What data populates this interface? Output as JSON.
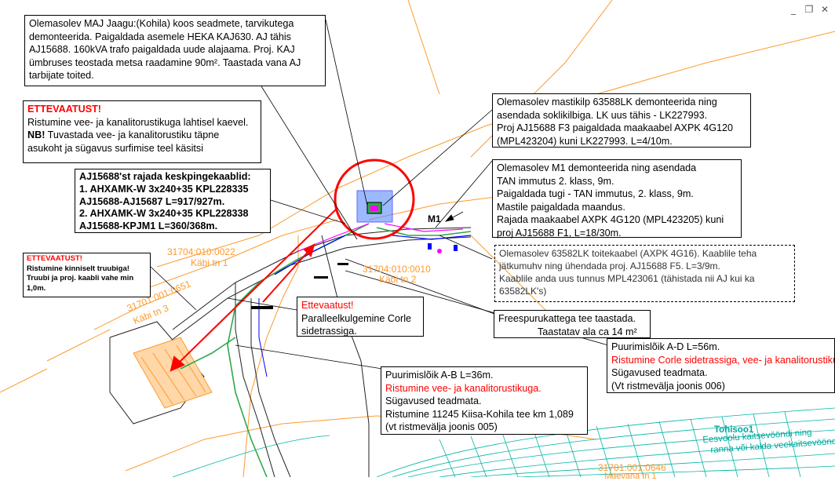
{
  "window_controls": {
    "minimize": "_",
    "restore": "❐",
    "close": "✕"
  },
  "notes": {
    "jaagu": {
      "lines": [
        "Olemasolev MAJ Jaagu:(Kohila) koos seadmete, tarvikutega",
        "demonteerida. Paigaldada asemele HEKA KAJ630. AJ tähis",
        "AJ15688. 160kVA trafo paigaldada uude alajaama. Proj. KAJ",
        "ümbruses teostada metsa raadamine 90m²",
        ". Taastada vana AJ",
        "tarbijate toited."
      ]
    },
    "warning1": {
      "title": "ETTEVAATUST!",
      "line1": "Ristumine vee- ja kanalitorustikuga lahtisel kaevel.",
      "nb": "NB!",
      "line2": " Tuvastada vee- ja kanalitorustiku täpne",
      "line3": "asukoht ja sügavus surfimise teel käsitsi"
    },
    "cables": {
      "lines": [
        "AJ15688'st rajada keskpingekaablid:",
        "1. AHXAMK-W 3x240+35 KPL228335",
        "AJ15688-AJ15687 L=917/927m.",
        "2. AHXAMK-W 3x240+35 KPL228338",
        "AJ15688-KPJM1 L=360/368m."
      ]
    },
    "warning2": {
      "title": "ETTEVAATUST!",
      "lines": [
        "Ristumine kinniselt truubiga!",
        "Truubi ja proj. kaabli vahe min",
        "1,0m."
      ]
    },
    "mastikilp": {
      "lines": [
        "Olemasolev mastikilp 63588LK demonteerida ning",
        "asendada soklikilbiga. LK uus tähis - LK227993.",
        "Proj AJ15688 F3 paigaldada maakaabel AXPK 4G120",
        "(MPL423204) kuni LK227993. L=4/10m."
      ]
    },
    "m1": {
      "lines": [
        "Olemasolev M1 demonteerida ning asendada",
        "TAN immutus 2. klass, 9m.",
        "Paigaldada tugi - TAN immutus, 2. klass, 9m.",
        "Mastile paigaldada maandus.",
        "Rajada maakaabel AXPK 4G120 (MPL423205) kuni",
        "proj AJ15688 F1, L=18/30m."
      ]
    },
    "lk63582": {
      "lines": [
        "Olemasolev 63582LK toitekaabel (AXPK 4G16). Kaablile teha",
        "jätkumuhv ning ühendada proj. AJ15688 F5. L=3/9m.",
        "Kaablile anda uus tunnus MPL423061 (tähistada nii AJ kui ka",
        "63582LK's)"
      ]
    },
    "ettevaatust3": {
      "title": "Ettevaatust!",
      "lines": [
        "Paralleelkulgemine Corle",
        "sidetrassiga."
      ]
    },
    "freespuru": {
      "line1": "Freespurukattega tee taastada.",
      "line2": "Taastatav ala ca 14 m²"
    },
    "ad": {
      "line1": "Puurimislõik A-D L=56m.",
      "red": "Ristumine Corle sidetrassiga, vee- ja kanalitorustikuga.",
      "line3": "Sügavused teadmata.",
      "line4": "(Vt ristmevälja joonis 006)"
    },
    "ab": {
      "line1": "Puurimislõik A-B L=36m.",
      "red": "Ristumine vee- ja kanalitorustikuga.",
      "line3": "Sügavused teadmata.",
      "line4": "Ristumine 11245 Kiisa-Kohila tee km 1,089",
      "line5": "(vt ristmevälja joonis 005)"
    }
  },
  "map_labels": {
    "m1": "M1",
    "parcel1_id": "31704:010:0022",
    "parcel1_name": "Käbi tn 1",
    "parcel2_id": "31704:010:0010",
    "parcel2_name": "Käbi tn 2",
    "parcel3_id": "31701:001:0651",
    "parcel3_name": "Käbi tn 3",
    "parcel4_id": "31701:001:0646",
    "parcel4_name": "Mäevana tn 1",
    "tohisoo": "Tohisoo1",
    "eesvool1": "Eesvoolu kaitsevööndi ning",
    "eesvool2": "ranna või kalda veekaitsevöönd"
  },
  "colors": {
    "red": "#ff0000",
    "orange": "#ff9a2e",
    "teal": "#00a79d",
    "green": "#2ea84a",
    "blue": "#0000ff"
  }
}
